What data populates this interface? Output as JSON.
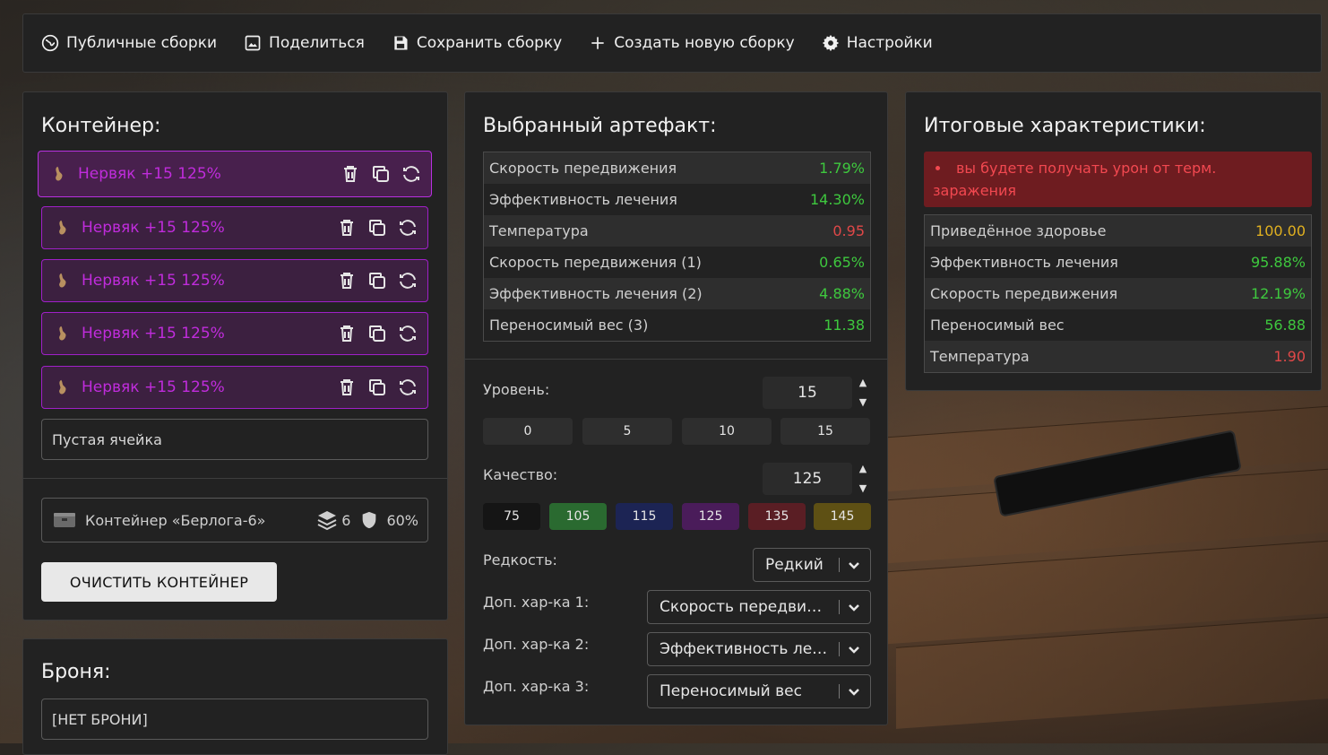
{
  "topbar": {
    "items": [
      {
        "label": "Публичные сборки",
        "icon": "globe-icon"
      },
      {
        "label": "Поделиться",
        "icon": "image-icon"
      },
      {
        "label": "Сохранить сборку",
        "icon": "floppy-icon"
      },
      {
        "label": "Создать новую сборку",
        "icon": "plus-icon"
      },
      {
        "label": "Настройки",
        "icon": "gear-icon"
      }
    ]
  },
  "container": {
    "title": "Контейнер:",
    "slots": [
      {
        "name": "Нервяк +15 125%"
      },
      {
        "name": "Нервяк +15 125%"
      },
      {
        "name": "Нервяк +15 125%"
      },
      {
        "name": "Нервяк +15 125%"
      },
      {
        "name": "Нервяк +15 125%"
      }
    ],
    "empty_cell": "Пустая ячейка",
    "container_name": "Контейнер «Берлога-6»",
    "slots_count": "6",
    "protection": "60%",
    "clear_button": "ОЧИСТИТЬ КОНТЕЙНЕР"
  },
  "armor": {
    "title": "Броня:",
    "value": "[НЕТ БРОНИ]"
  },
  "artifact": {
    "title": "Выбранный артефакт:",
    "stats": [
      {
        "label": "Скорость передвижения",
        "value": "1.79%",
        "color": "green"
      },
      {
        "label": "Эффективность лечения",
        "value": "14.30%",
        "color": "green"
      },
      {
        "label": "Температура",
        "value": "0.95",
        "color": "red"
      },
      {
        "label": "Скорость передвижения (1)",
        "value": "0.65%",
        "color": "green"
      },
      {
        "label": "Эффективность лечения (2)",
        "value": "4.88%",
        "color": "green"
      },
      {
        "label": "Переносимый вес (3)",
        "value": "11.38",
        "color": "green"
      }
    ],
    "level_label": "Уровень:",
    "level_value": "15",
    "level_presets": [
      "0",
      "5",
      "10",
      "15"
    ],
    "quality_label": "Качество:",
    "quality_value": "125",
    "quality_presets": [
      {
        "label": "75",
        "color": "#151515"
      },
      {
        "label": "105",
        "color": "#2a6a30"
      },
      {
        "label": "115",
        "color": "#1c2454"
      },
      {
        "label": "125",
        "color": "#4a1c5a"
      },
      {
        "label": "135",
        "color": "#5a1e24"
      },
      {
        "label": "145",
        "color": "#5e5014"
      }
    ],
    "rarity_label": "Редкость:",
    "rarity_value": "Редкий",
    "extra1_label": "Доп. хар-ка 1:",
    "extra1_value": "Скорость передвижения",
    "extra2_label": "Доп. хар-ка 2:",
    "extra2_value": "Эффективность лечения",
    "extra3_label": "Доп. хар-ка 3:",
    "extra3_value": "Переносимый вес"
  },
  "summary": {
    "title": "Итоговые характеристики:",
    "warning": "вы будете получать урон от терм. заражения",
    "stats": [
      {
        "label": "Приведённое здоровье",
        "value": "100.00",
        "color": "gold"
      },
      {
        "label": "Эффективность лечения",
        "value": "95.88%",
        "color": "green"
      },
      {
        "label": "Скорость передвижения",
        "value": "12.19%",
        "color": "green"
      },
      {
        "label": "Переносимый вес",
        "value": "56.88",
        "color": "green"
      },
      {
        "label": "Температура",
        "value": "1.90",
        "color": "red"
      }
    ]
  }
}
